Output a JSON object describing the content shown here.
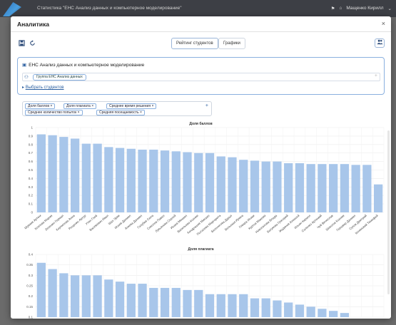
{
  "appbar": {
    "title": "Статистика \"ЕНС Анализ данных и компьютерное моделирование\"",
    "user": "Мащенко Кирилл"
  },
  "modal": {
    "title": "Аналитика",
    "close": "×"
  },
  "toolbar": {
    "tab_rating": "Рейтинг студентов",
    "tab_charts": "Графики",
    "icons": [
      "save-icon",
      "refresh-icon",
      "people-icon"
    ]
  },
  "group_panel": {
    "title": "ЕНС Анализ данных и компьютерное моделирование",
    "group_chip": "Группа ЕНС Анализ данных",
    "plus": "+",
    "select_link": "Выбрать студентов"
  },
  "metrics": {
    "chips": [
      "Доля баллов",
      "Доля плагиата",
      "Среднее время решения",
      "Среднее количество попыток",
      "Средняя посещаемость"
    ],
    "plus": "+"
  },
  "chart_data": [
    {
      "type": "bar",
      "title": "Доля баллов",
      "categories": [
        "Шуваев Артем",
        "Козлова Мария",
        "Зеленин Герман",
        "Корнилова Анна",
        "Рощенко Артур",
        "Утин Глеб",
        "Васюкевич Иван",
        "Шах Эрик",
        "Исаев Даниил",
        "Ачкова Даниил",
        "Голубев Сила",
        "Соколов Павел",
        "Лукьянова Сергей",
        "Исаев Михаил",
        "Васильева Ксения",
        "Кондрашов Михаил",
        "Пыталева Маргарита",
        "Белоногова Дарья",
        "Бельская Ирина",
        "Гевара Исаак",
        "Куртов Максим",
        "Новоселова Влада",
        "Батукова Григорий",
        "Жадинов Алексей",
        "Ильин Кирилл",
        "Саленко Артемий",
        "Чуб Вячеслав",
        "Шокотов Ксения",
        "Гершвер Даниил",
        "Сухов Дмитрий",
        "Кочинский Тимофей"
      ],
      "values": [
        0.92,
        0.91,
        0.89,
        0.87,
        0.81,
        0.81,
        0.77,
        0.76,
        0.75,
        0.74,
        0.74,
        0.73,
        0.72,
        0.71,
        0.7,
        0.7,
        0.66,
        0.65,
        0.62,
        0.61,
        0.6,
        0.6,
        0.58,
        0.58,
        0.57,
        0.57,
        0.57,
        0.57,
        0.56,
        0.56,
        0.33
      ],
      "ylim": [
        0,
        1
      ],
      "yticks": [
        "0",
        "0.1",
        "0.2",
        "0.3",
        "0.4",
        "0.5",
        "0.6",
        "0.7",
        "0.8",
        "0.9",
        "1"
      ],
      "grid": true
    },
    {
      "type": "bar",
      "title": "Доля плагиата",
      "values": [
        0.36,
        0.33,
        0.31,
        0.3,
        0.3,
        0.3,
        0.28,
        0.27,
        0.26,
        0.26,
        0.24,
        0.24,
        0.24,
        0.23,
        0.23,
        0.21,
        0.21,
        0.21,
        0.21,
        0.19,
        0.19,
        0.18,
        0.17,
        0.16,
        0.15,
        0.14,
        0.13,
        0.12
      ],
      "ylim": [
        0.1,
        0.4
      ],
      "yticks": [
        "0.1",
        "0.15",
        "0.2",
        "0.25",
        "0.3",
        "0.35",
        "0.4"
      ],
      "grid": true
    }
  ],
  "colors": {
    "bar": "#a8c6ea",
    "accent": "#2b5fa0",
    "border": "#8ab0df"
  }
}
